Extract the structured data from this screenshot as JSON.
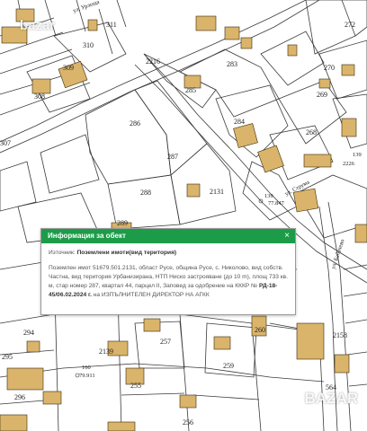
{
  "watermark_top": "bazar",
  "watermark_bottom": "BAZAR",
  "map": {
    "parcel_numbers": [
      "272",
      "311",
      "310",
      "309",
      "308",
      "2216",
      "283",
      "270",
      "285",
      "286",
      "269",
      "284",
      "268",
      "287",
      "2131",
      "288",
      "289",
      "257",
      "2139",
      "255",
      "259",
      "256",
      "294",
      "295",
      "296",
      "307",
      "564",
      "2226",
      "260",
      "2158",
      "139"
    ],
    "street_labels": [
      "ул. Струма",
      "ул. Бабачево",
      "ул. Урлеща"
    ],
    "spot_elevations": [
      "77.847",
      "79.911"
    ],
    "small_labels": [
      "160",
      "139"
    ]
  },
  "popup": {
    "title": "Информация за обект",
    "close_icon": "×",
    "source_label": "Източник:",
    "source_value": "Поземлени имоти(вид територия)",
    "desc_prefix": "Поземлен имот 51679.501.2131, област Русе, община Русе, с. Николово, вид собств. Частна, вид територия Урбанизирана, НТП Ниско застрояване (до 10 m), площ 733 кв. м, стар номер 287, квартал 44, парцел II, Заповед за одобрение на КККР №",
    "desc_order": "РД-18-45/06.02.2024 г.",
    "desc_suffix": "на ИЗПЪЛНИТЕЛЕН ДИРЕКТОР НА АГКК"
  }
}
